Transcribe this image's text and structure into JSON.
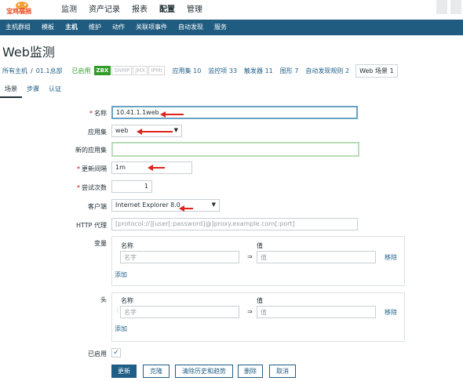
{
  "brand": {
    "logo_text": "宝鸡福捐",
    "logo_color": "#e64b1e"
  },
  "top_menu": [
    {
      "label": "监测",
      "active": false
    },
    {
      "label": "资产记录",
      "active": false
    },
    {
      "label": "报表",
      "active": false
    },
    {
      "label": "配置",
      "active": true
    },
    {
      "label": "管理",
      "active": false
    }
  ],
  "sub_nav": [
    {
      "label": "主机群组",
      "active": false
    },
    {
      "label": "模板",
      "active": false
    },
    {
      "label": "主机",
      "active": true
    },
    {
      "label": "维护",
      "active": false
    },
    {
      "label": "动作",
      "active": false
    },
    {
      "label": "关联项事件",
      "active": false
    },
    {
      "label": "自动发现",
      "active": false
    },
    {
      "label": "服务",
      "active": false
    }
  ],
  "page_title": "Web监测",
  "breadcrumb": {
    "all_hosts": "所有主机",
    "separator": "/",
    "host": "01.1总部",
    "status": "已启用",
    "badges": [
      {
        "label": "ZBX",
        "on": true
      },
      {
        "label": "SNMP",
        "on": false
      },
      {
        "label": "JMX",
        "on": false
      },
      {
        "label": "IPMI",
        "on": false
      }
    ],
    "items": [
      {
        "label": "应用集 10"
      },
      {
        "label": "监控项 33"
      },
      {
        "label": "触发器 11"
      },
      {
        "label": "图形 7"
      },
      {
        "label": "自动发现规则 2"
      }
    ],
    "current": "Web 场景 1"
  },
  "tabs": [
    {
      "label": "场景",
      "active": true
    },
    {
      "label": "步骤",
      "active": false
    },
    {
      "label": "认证",
      "active": false
    }
  ],
  "form": {
    "name_label": "名称",
    "name_value": "10.41.1.1web",
    "appset_label": "应用集",
    "appset_value": "web",
    "new_appset_label": "新的应用集",
    "new_appset_value": "",
    "interval_label": "更新间隔",
    "interval_value": "1m",
    "attempts_label": "尝试次数",
    "attempts_value": "1",
    "agent_label": "客户端",
    "agent_value": "Internet Explorer 8.0",
    "proxy_label": "HTTP 代理",
    "proxy_placeholder": "[protocol://][user[:password]@]proxy.example.com[:port]",
    "variables_label": "变量",
    "headers_label": "头",
    "col_name": "名称",
    "col_value": "值",
    "name_placeholder": "名字",
    "value_placeholder": "值",
    "eq_sign": "⇒",
    "remove_label": "移除",
    "add_label": "添加",
    "enabled_label": "已启用",
    "enabled_checked": true,
    "check_mark": "✓"
  },
  "buttons": {
    "update": "更新",
    "clone": "克隆",
    "clear_history": "清除历史和趋势",
    "delete": "删除",
    "cancel": "取消"
  },
  "colors": {
    "nav_bg": "#205c7f",
    "link": "#1f5e85",
    "enabled_green": "#2f9d27",
    "annotation_arrow": "#e1231b"
  }
}
